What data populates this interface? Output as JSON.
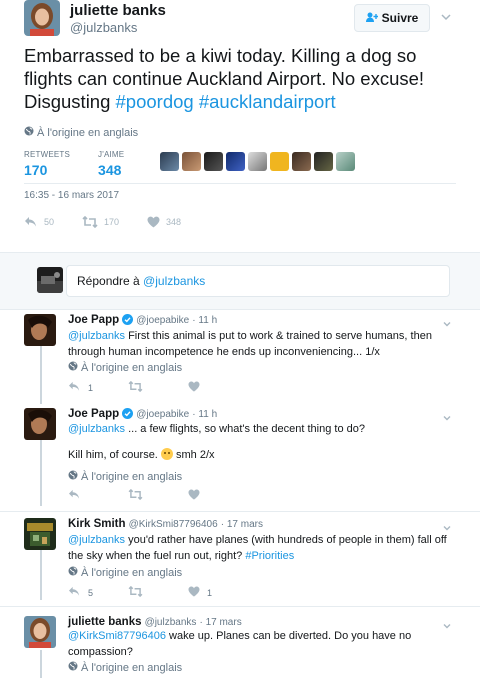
{
  "main_tweet": {
    "name": "juliette banks",
    "handle": "@julzbanks",
    "follow_label": "Suivre",
    "text_plain": "Embarrassed to be a kiwi today. Killing a dog so flights can continue Auckland Airport. No excuse! Disgusting ",
    "hashtag1": "#poordog",
    "hashtag2": "#aucklandairport",
    "translate_label": "À l'origine en anglais",
    "retweets_label": "RETWEETS",
    "retweets_value": "170",
    "likes_label": "J'AIME",
    "likes_value": "348",
    "timestamp": "16:35 - 16 mars 2017",
    "actions": {
      "replies": "50",
      "retweets": "170",
      "likes": "348"
    }
  },
  "composer": {
    "placeholder_prefix": "Répondre à ",
    "placeholder_handle": "@julzbanks"
  },
  "replies": [
    {
      "name": "Joe Papp",
      "handle": "@joepabike",
      "time": "· 11 h",
      "mention": "@julzbanks",
      "text": " First this animal is put to work & trained to serve humans, then through human incompetence he ends up inconveniencing... 1/x",
      "translate_label": "À l'origine en anglais",
      "reply_count": "1",
      "retweet_count": "",
      "like_count": ""
    },
    {
      "name": "Joe Papp",
      "handle": "@joepabike",
      "time": "· 11 h",
      "mention": "@julzbanks",
      "text": " ... a few flights, so what's the decent thing to do?",
      "text2_a": "Kill him, of course.",
      "text2_b": " smh 2/x",
      "translate_label": "À l'origine en anglais",
      "reply_count": "",
      "retweet_count": "",
      "like_count": ""
    },
    {
      "name": "Kirk Smith",
      "handle": "@KirkSmi87796406",
      "time": "· 17 mars",
      "mention": "@julzbanks",
      "text": " you'd rather have planes (with hundreds of people in them) fall off the sky when the fuel run out, right? ",
      "hashtag": "#Priorities",
      "translate_label": "À l'origine en anglais",
      "reply_count": "5",
      "retweet_count": "",
      "like_count": "1"
    },
    {
      "name": "juliette banks",
      "handle": "@julzbanks",
      "time": "· 17 mars",
      "mention": "@KirkSmi87796406",
      "text": " wake up. Planes can be diverted. Do you have no compassion?",
      "translate_label": "À l'origine en anglais"
    }
  ],
  "colors": {
    "link": "#1b95e0",
    "muted": "#657786",
    "divider": "#e6ecf0"
  },
  "icons": [
    "globe-icon",
    "reply-icon",
    "retweet-icon",
    "like-icon",
    "verified-icon",
    "chevron-down-icon",
    "follow-icon"
  ]
}
